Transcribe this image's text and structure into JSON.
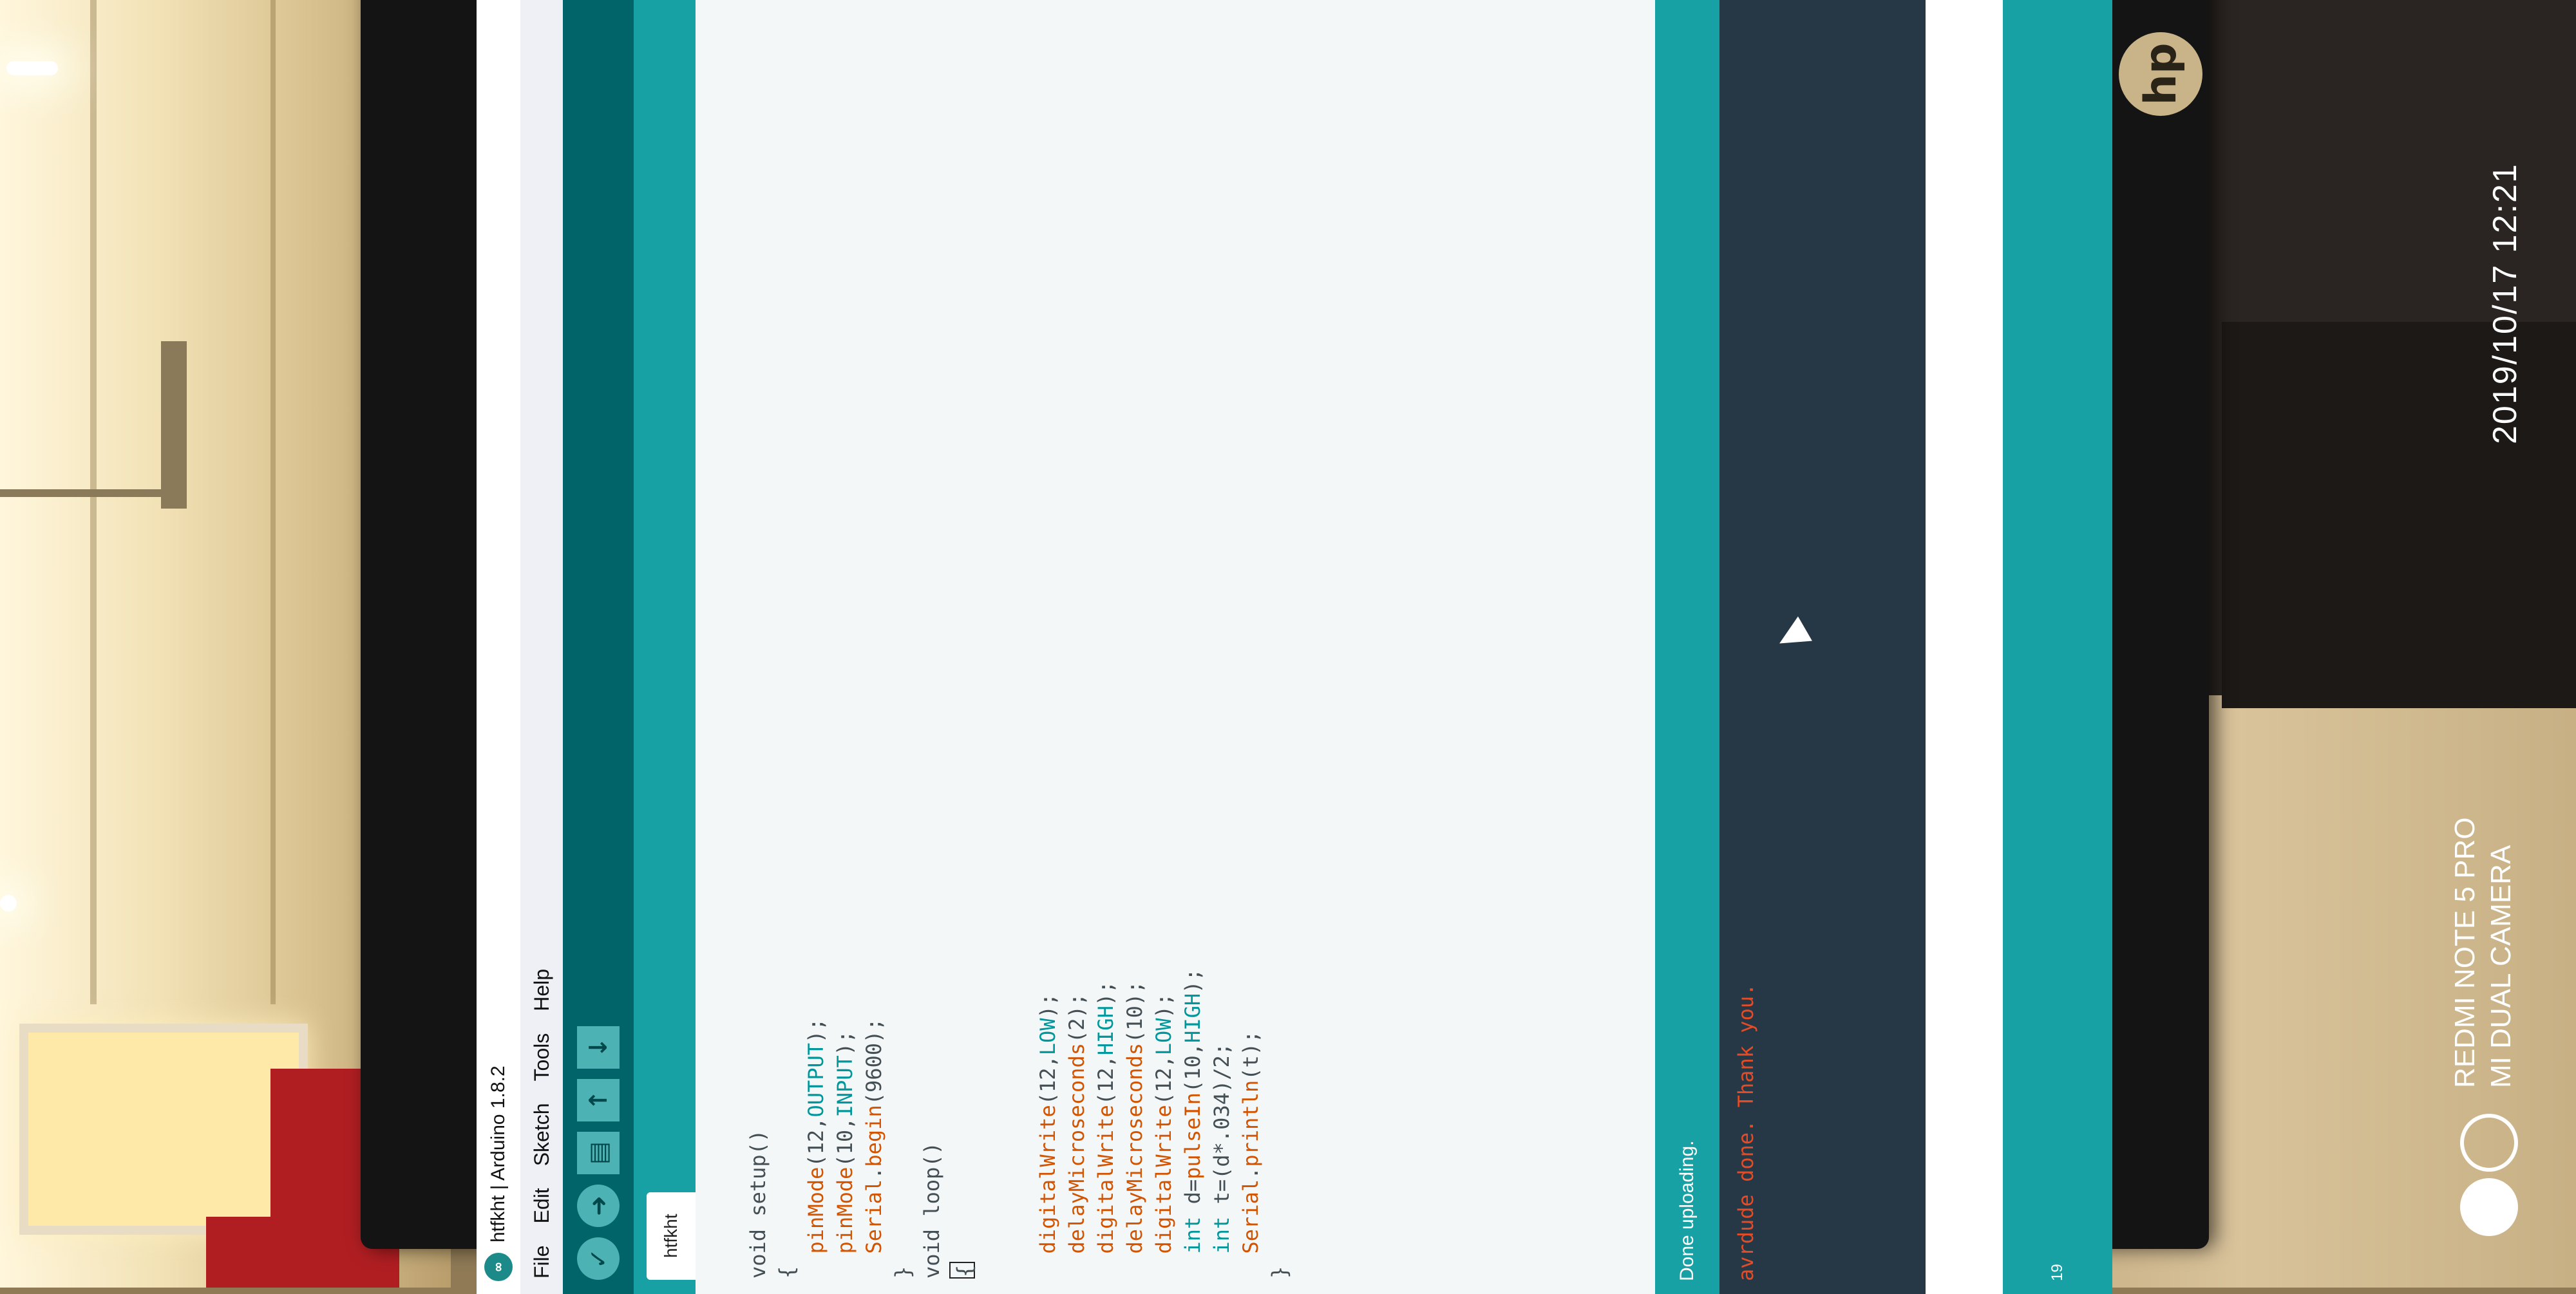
{
  "window": {
    "title": "htfkht | Arduino 1.8.2",
    "logo_icon": "arduino-infinity-icon"
  },
  "menu": [
    "File",
    "Edit",
    "Sketch",
    "Tools",
    "Help"
  ],
  "toolbar": {
    "buttons": [
      {
        "name": "verify",
        "icon": "check-icon",
        "glyph": "✓"
      },
      {
        "name": "upload",
        "icon": "arrow-right-icon",
        "glyph": "➜"
      },
      {
        "name": "new",
        "icon": "new-file-icon",
        "glyph": "▤"
      },
      {
        "name": "open",
        "icon": "arrow-up-icon",
        "glyph": "↑"
      },
      {
        "name": "save",
        "icon": "arrow-down-icon",
        "glyph": "↓"
      }
    ]
  },
  "tab": {
    "label": "htfkht"
  },
  "status": {
    "message": "Done uploading."
  },
  "console": {
    "output": "avrdude done.  Thank you."
  },
  "footer": {
    "line_number": "19"
  },
  "overlay": {
    "datetime": "2019/10/17   12:21",
    "device_line1": "REDMI NOTE 5 PRO",
    "device_line2": "MI DUAL CAMERA"
  },
  "brand": {
    "logo_text": "hp"
  },
  "colors": {
    "toolbar": "#006468",
    "tabbar": "#17a1a5",
    "console_bg": "#263846",
    "console_text": "#e34c26",
    "keyword_orange": "#d35400",
    "constant_teal": "#00979c"
  },
  "code": [
    [],
    [
      {
        "t": "void setup()",
        "c": "plain"
      }
    ],
    [
      {
        "t": "{",
        "c": "plain"
      }
    ],
    [
      {
        "t": "  pinMode",
        "c": "orange"
      },
      {
        "t": "(12,",
        "c": "plain"
      },
      {
        "t": "OUTPUT",
        "c": "teal"
      },
      {
        "t": ");",
        "c": "plain"
      }
    ],
    [
      {
        "t": "  pinMode",
        "c": "orange"
      },
      {
        "t": "(10,",
        "c": "plain"
      },
      {
        "t": "INPUT",
        "c": "teal"
      },
      {
        "t": ");",
        "c": "plain"
      }
    ],
    [
      {
        "t": "  Serial",
        "c": "orange"
      },
      {
        "t": ".",
        "c": "plain"
      },
      {
        "t": "begin",
        "c": "orange"
      },
      {
        "t": "(9600);",
        "c": "plain"
      }
    ],
    [
      {
        "t": "}",
        "c": "plain"
      }
    ],
    [
      {
        "t": "void loop()",
        "c": "plain"
      }
    ],
    [
      {
        "t": "{",
        "c": "caret"
      }
    ],
    [],
    [],
    [
      {
        "t": "  digitalWrite",
        "c": "orange"
      },
      {
        "t": "(12,",
        "c": "plain"
      },
      {
        "t": "LOW",
        "c": "teal"
      },
      {
        "t": ");",
        "c": "plain"
      }
    ],
    [
      {
        "t": "  delayMicroseconds",
        "c": "orange"
      },
      {
        "t": "(2);",
        "c": "plain"
      }
    ],
    [
      {
        "t": "  digitalWrite",
        "c": "orange"
      },
      {
        "t": "(12,",
        "c": "plain"
      },
      {
        "t": "HIGH",
        "c": "teal"
      },
      {
        "t": ");",
        "c": "plain"
      }
    ],
    [
      {
        "t": "  delayMicroseconds",
        "c": "orange"
      },
      {
        "t": "(10);",
        "c": "plain"
      }
    ],
    [
      {
        "t": "  digitalWrite",
        "c": "orange"
      },
      {
        "t": "(12,",
        "c": "plain"
      },
      {
        "t": "LOW",
        "c": "teal"
      },
      {
        "t": ");",
        "c": "plain"
      }
    ],
    [
      {
        "t": "  int",
        "c": "type"
      },
      {
        "t": " d=",
        "c": "plain"
      },
      {
        "t": "pulseIn",
        "c": "orange"
      },
      {
        "t": "(10,",
        "c": "plain"
      },
      {
        "t": "HIGH",
        "c": "teal"
      },
      {
        "t": ");",
        "c": "plain"
      }
    ],
    [
      {
        "t": "  int",
        "c": "type"
      },
      {
        "t": " t=(d*.034)/2;",
        "c": "plain"
      }
    ],
    [
      {
        "t": "  Serial",
        "c": "orange"
      },
      {
        "t": ".",
        "c": "plain"
      },
      {
        "t": "println",
        "c": "orange"
      },
      {
        "t": "(t);",
        "c": "plain"
      }
    ],
    [
      {
        "t": "}",
        "c": "plain"
      }
    ]
  ]
}
